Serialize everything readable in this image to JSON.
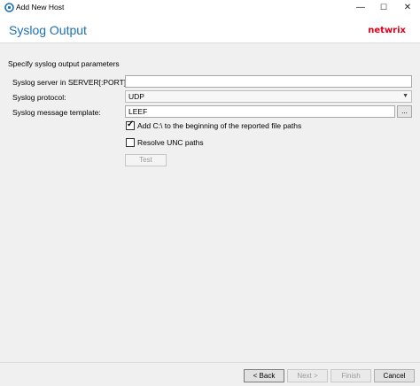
{
  "window": {
    "title": "Add New Host",
    "minimize_glyph": "—",
    "maximize_glyph": "☐",
    "close_glyph": "✕"
  },
  "header": {
    "page_title": "Syslog Output",
    "logo_text": "netwrix"
  },
  "main": {
    "intro": "Specify syslog output parameters",
    "server": {
      "label": "Syslog server in SERVER[:PORT] format:",
      "value": ""
    },
    "protocol": {
      "label": "Syslog protocol:",
      "value": "UDP"
    },
    "template": {
      "label": "Syslog message template:",
      "value": "LEEF",
      "browse_label": "..."
    },
    "add_c": {
      "label": "Add C:\\ to the beginning of the reported file paths",
      "checked": true
    },
    "resolve_unc": {
      "label": "Resolve UNC paths",
      "checked": false
    },
    "test_label": "Test"
  },
  "footer": {
    "back_label": "< Back",
    "next_label": "Next >",
    "finish_label": "Finish",
    "cancel_label": "Cancel"
  },
  "colors": {
    "title_blue": "#1c6fb5",
    "logo_red": "#e0001b"
  },
  "icons": {
    "app": "app-icon",
    "dropdown": "chevron-down-icon",
    "check": "checkmark-icon"
  }
}
